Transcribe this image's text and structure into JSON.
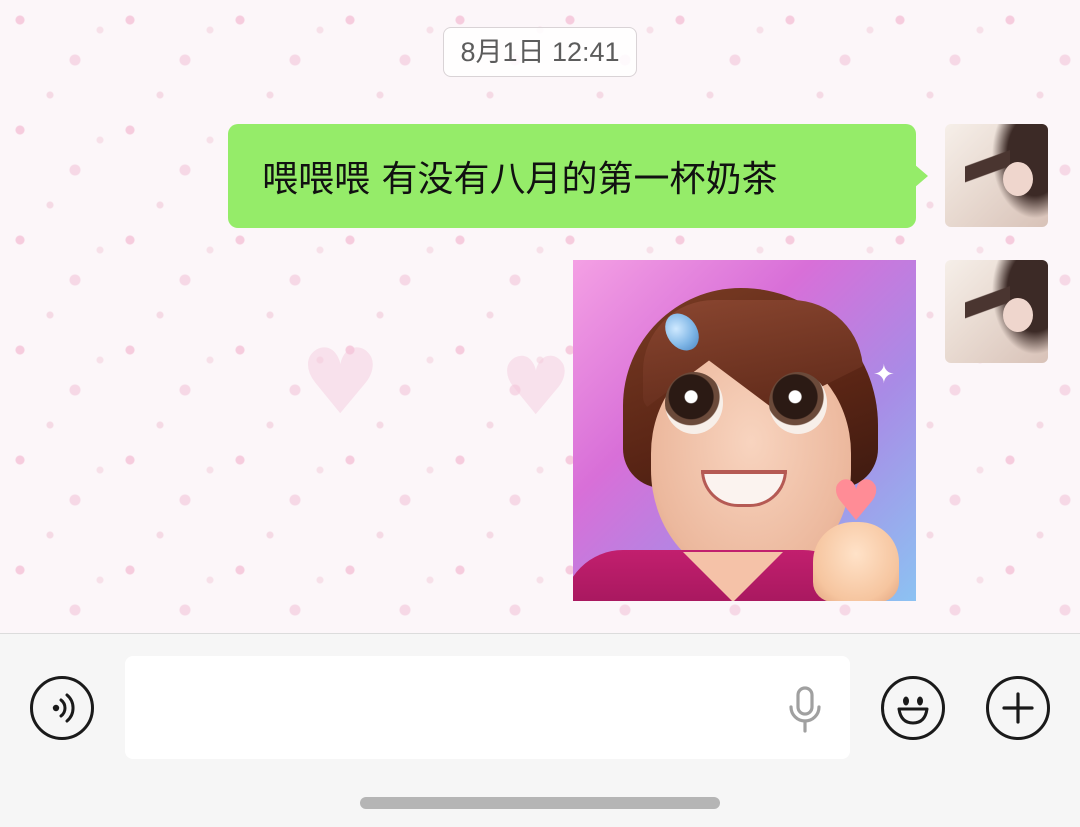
{
  "chat": {
    "timestamp": "8月1日 12:41",
    "messages": [
      {
        "type": "text",
        "sender": "self",
        "text": "喂喂喂 有没有八月的第一杯奶茶"
      },
      {
        "type": "sticker",
        "sender": "self"
      }
    ]
  },
  "input_bar": {
    "placeholder": "",
    "value": "",
    "icons": {
      "voice": "voice-icon",
      "mic": "microphone-icon",
      "emoji": "emoji-icon",
      "more": "plus-icon"
    }
  },
  "colors": {
    "bubble_self": "#95ec69",
    "input_bar_bg": "#f6f6f6"
  }
}
